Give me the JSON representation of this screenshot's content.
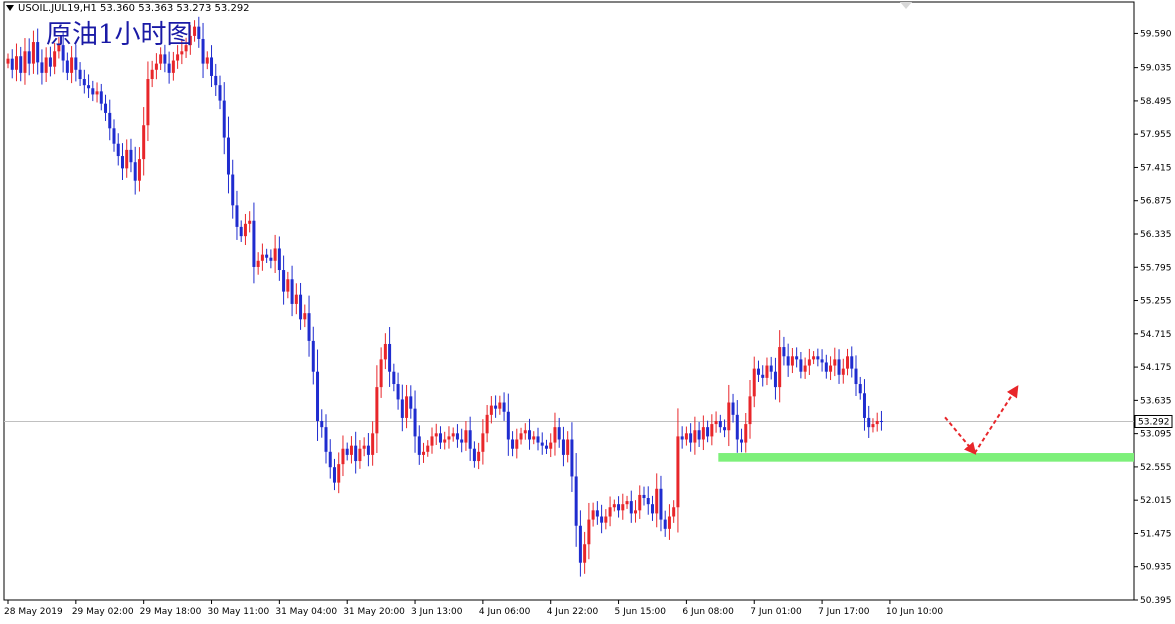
{
  "header": {
    "symbol_info": "USOIL.JUL19,H1  53.360 53.363 53.273 53.292",
    "overlay_title": "原油1小时图",
    "current_price": "53.292"
  },
  "colors": {
    "bull": "#e8262a",
    "bear": "#1f2ccf",
    "support_zone": "#7df07a",
    "arrow": "#e8262a",
    "axis": "#000000",
    "current_line": "#c0c0c0"
  },
  "chart_data": {
    "type": "candlestick",
    "symbol": "USOIL.JUL19",
    "timeframe": "H1",
    "ylim": [
      50.395,
      60.1
    ],
    "y_ticks": [
      "59.590",
      "59.035",
      "58.495",
      "57.955",
      "57.415",
      "56.875",
      "56.335",
      "55.795",
      "55.255",
      "54.715",
      "54.175",
      "53.635",
      "53.095",
      "52.555",
      "52.015",
      "51.475",
      "50.935",
      "50.395"
    ],
    "x_ticks": [
      {
        "label": "28 May 2019",
        "idx": 0
      },
      {
        "label": "29 May 02:00",
        "idx": 16
      },
      {
        "label": "29 May 18:00",
        "idx": 32
      },
      {
        "label": "30 May 11:00",
        "idx": 48
      },
      {
        "label": "31 May 04:00",
        "idx": 64
      },
      {
        "label": "31 May 20:00",
        "idx": 80
      },
      {
        "label": "3 Jun 13:00",
        "idx": 96
      },
      {
        "label": "4 Jun 06:00",
        "idx": 112
      },
      {
        "label": "4 Jun 22:00",
        "idx": 128
      },
      {
        "label": "5 Jun 15:00",
        "idx": 144
      },
      {
        "label": "6 Jun 08:00",
        "idx": 160
      },
      {
        "label": "7 Jun 01:00",
        "idx": 176
      },
      {
        "label": "7 Jun 17:00",
        "idx": 192
      },
      {
        "label": "10 Jun 10:00",
        "idx": 208
      }
    ],
    "current_price": 53.292,
    "support_zone": {
      "low": 52.64,
      "high": 52.78,
      "from_idx": 168,
      "to_idx": 283
    },
    "projection": [
      {
        "idx": 221,
        "price": 53.36
      },
      {
        "idx": 228,
        "price": 52.78
      },
      {
        "idx": 238,
        "price": 53.85
      }
    ],
    "closes": [
      59.18,
      59.0,
      59.22,
      58.95,
      59.3,
      59.1,
      59.45,
      59.12,
      58.95,
      59.2,
      59.05,
      59.3,
      59.4,
      59.15,
      58.95,
      59.2,
      59.0,
      58.85,
      58.75,
      58.7,
      58.6,
      58.65,
      58.45,
      58.3,
      58.05,
      57.8,
      57.6,
      57.4,
      57.7,
      57.5,
      57.2,
      57.55,
      58.1,
      58.85,
      59.0,
      59.1,
      59.25,
      59.1,
      58.95,
      59.15,
      59.25,
      59.3,
      59.4,
      59.55,
      59.7,
      59.5,
      59.1,
      59.2,
      58.9,
      58.75,
      58.5,
      57.9,
      57.3,
      56.8,
      56.45,
      56.3,
      56.5,
      56.55,
      55.8,
      55.9,
      56.0,
      55.95,
      55.9,
      56.1,
      55.75,
      55.4,
      55.6,
      55.2,
      55.35,
      54.95,
      55.05,
      54.6,
      54.1,
      53.3,
      53.2,
      52.8,
      52.55,
      52.3,
      52.6,
      52.85,
      52.75,
      52.9,
      52.65,
      52.85,
      52.9,
      52.75,
      53.1,
      53.85,
      54.3,
      54.55,
      54.1,
      53.9,
      53.65,
      53.35,
      53.7,
      53.5,
      53.05,
      52.75,
      52.8,
      52.9,
      53.05,
      53.1,
      52.95,
      53.0,
      53.05,
      53.1,
      53.0,
      52.95,
      53.15,
      52.85,
      52.65,
      52.8,
      53.1,
      53.4,
      53.55,
      53.5,
      53.6,
      53.45,
      53.0,
      52.85,
      53.0,
      53.1,
      53.15,
      53.0,
      53.05,
      52.95,
      52.9,
      52.85,
      52.95,
      53.2,
      53.0,
      52.75,
      53.0,
      52.4,
      51.6,
      51.0,
      51.3,
      51.7,
      51.85,
      51.75,
      51.65,
      51.75,
      51.9,
      51.95,
      51.85,
      51.95,
      52.0,
      51.8,
      51.85,
      52.1,
      52.05,
      51.95,
      51.8,
      52.2,
      51.7,
      51.55,
      51.75,
      51.9,
      53.05,
      53.0,
      53.1,
      52.95,
      53.15,
      53.0,
      53.2,
      53.05,
      53.25,
      53.3,
      53.2,
      53.15,
      53.6,
      53.4,
      53.0,
      52.95,
      53.25,
      53.7,
      54.15,
      54.05,
      54.0,
      54.2,
      54.1,
      53.85,
      54.5,
      54.35,
      54.2,
      54.35,
      54.3,
      54.1,
      54.2,
      54.3,
      54.35,
      54.3,
      54.25,
      54.1,
      54.2,
      54.3,
      54.05,
      54.15,
      54.35,
      54.15,
      53.9,
      53.75,
      53.35,
      53.2,
      53.25,
      53.3,
      53.29
    ]
  }
}
